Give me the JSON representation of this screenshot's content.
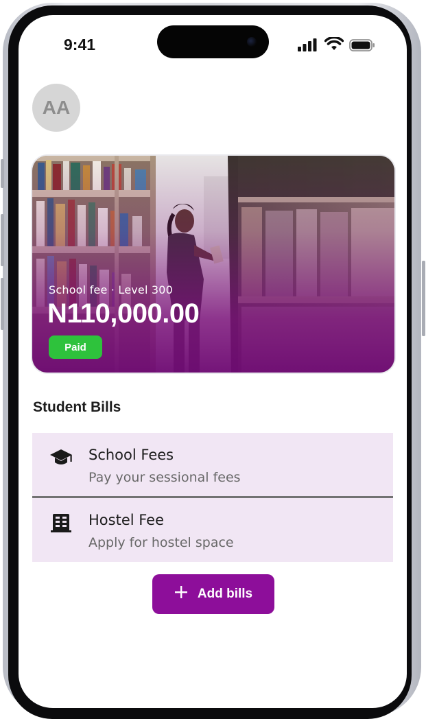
{
  "status_bar": {
    "time": "9:41",
    "icons": [
      "cellular-signal-icon",
      "wifi-icon",
      "battery-icon"
    ]
  },
  "profile": {
    "avatar_initials": "AA"
  },
  "hero_card": {
    "fee_label": "School fee · Level 300",
    "amount": "N110,000.00",
    "status_badge": "Paid",
    "overlay_color": "#7a0f7a",
    "badge_color": "#2ec23c"
  },
  "student_bills": {
    "title": "Student Bills",
    "items": [
      {
        "title": "School Fees",
        "subtitle": "Pay your sessional fees",
        "icon": "graduation-cap-icon"
      },
      {
        "title": "Hostel Fee",
        "subtitle": "Apply for hostel space",
        "icon": "building-icon"
      }
    ],
    "item_bg_color": "#f1e6f4"
  },
  "actions": {
    "add_bills_label": "Add bills",
    "add_bills_icon": "plus-icon",
    "accent_color": "#8d0e9a"
  }
}
